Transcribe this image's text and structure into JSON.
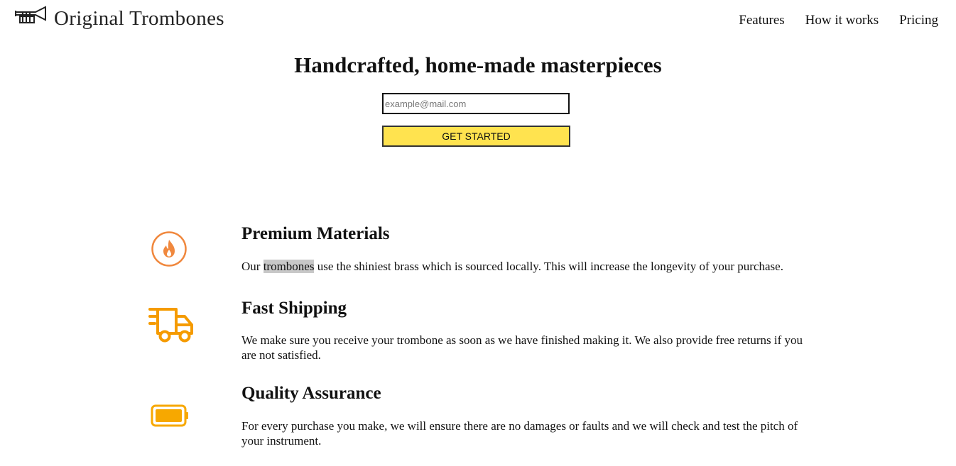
{
  "header": {
    "logo_text": "Original Trombones",
    "logo_icon": "trumpet-icon",
    "nav": [
      {
        "label": "Features"
      },
      {
        "label": "How it works"
      },
      {
        "label": "Pricing"
      }
    ]
  },
  "hero": {
    "title": "Handcrafted, home-made masterpieces",
    "email_placeholder": "example@mail.com",
    "cta_label": "GET STARTED"
  },
  "features": [
    {
      "icon": "flame-icon",
      "title": "Premium Materials",
      "text_before": "Our ",
      "text_highlight": "trombones",
      "text_after": " use the shiniest brass which is sourced locally. This will increase the longevity of your purchase."
    },
    {
      "icon": "truck-icon",
      "title": "Fast Shipping",
      "text": "We make sure you receive your trombone as soon as we have finished making it. We also provide free returns if you are not satisfied."
    },
    {
      "icon": "battery-icon",
      "title": "Quality Assurance",
      "text": "For every purchase you make, we will ensure there are no damages or faults and we will check and test the pitch of your instrument."
    }
  ],
  "colors": {
    "cta_background": "#ffe34f",
    "flame_icon": "#f0883e",
    "truck_icon": "#f59b00",
    "battery_icon": "#f7a800",
    "highlight": "#c8c8c8"
  }
}
